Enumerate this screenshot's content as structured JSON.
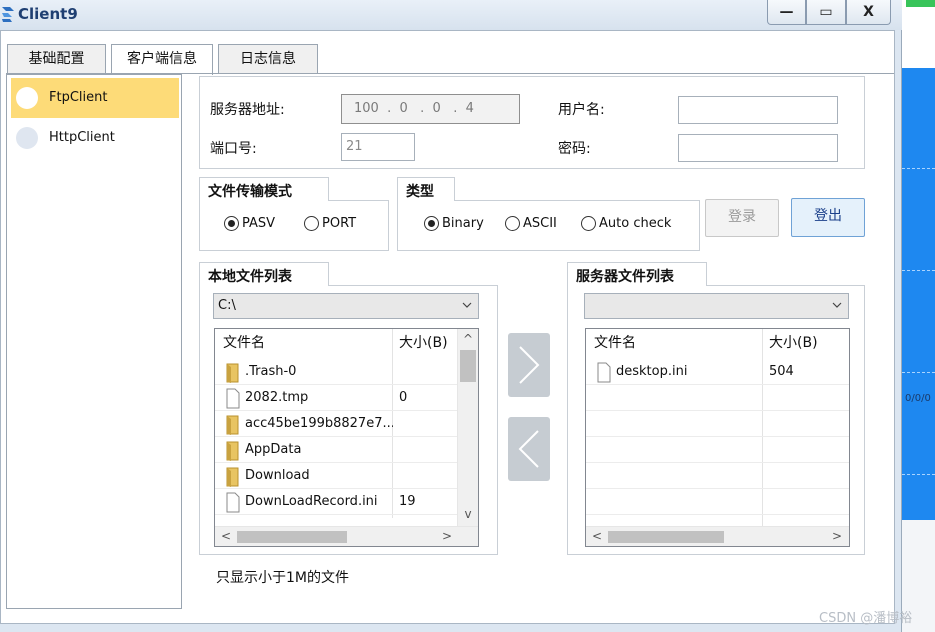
{
  "window": {
    "title": "Client9",
    "controls": {
      "minimize": "—",
      "maximize": "▭",
      "close": "X"
    }
  },
  "tabs": [
    {
      "label": "基础配置",
      "selected": false
    },
    {
      "label": "客户端信息",
      "selected": true
    },
    {
      "label": "日志信息",
      "selected": false
    }
  ],
  "left_list": [
    {
      "label": "FtpClient",
      "selected": true
    },
    {
      "label": "HttpClient",
      "selected": false
    }
  ],
  "connection": {
    "server_addr_label": "服务器地址:",
    "server_addr_value": "100  .  0   .  0   .  4",
    "port_label": "端口号:",
    "port_value": "21",
    "username_label": "用户名:",
    "username_value": "",
    "password_label": "密码:",
    "password_value": ""
  },
  "transfer_mode": {
    "title": "文件传输模式",
    "options": [
      {
        "label": "PASV",
        "checked": true
      },
      {
        "label": "PORT",
        "checked": false
      }
    ]
  },
  "type_group": {
    "title": "类型",
    "options": [
      {
        "label": "Binary",
        "checked": true
      },
      {
        "label": "ASCII",
        "checked": false
      },
      {
        "label": "Auto check",
        "checked": false
      }
    ]
  },
  "buttons": {
    "login": "登录",
    "logout": "登出"
  },
  "local_files": {
    "title": "本地文件列表",
    "path": "C:\\",
    "col_name": "文件名",
    "col_size": "大小(B)",
    "rows": [
      {
        "name": ".Trash-0",
        "size": "",
        "icon": "folder-icon"
      },
      {
        "name": "2082.tmp",
        "size": "0",
        "icon": "file-icon"
      },
      {
        "name": "acc45be199b8827e7...",
        "size": "",
        "icon": "folder-icon"
      },
      {
        "name": "AppData",
        "size": "",
        "icon": "folder-icon"
      },
      {
        "name": "Download",
        "size": "",
        "icon": "folder-icon"
      },
      {
        "name": "DownLoadRecord.ini",
        "size": "19",
        "icon": "file-icon"
      }
    ]
  },
  "server_files": {
    "title": "服务器文件列表",
    "path": "",
    "col_name": "文件名",
    "col_size": "大小(B)",
    "rows": [
      {
        "name": "desktop.ini",
        "size": "504",
        "icon": "file-icon"
      }
    ]
  },
  "transfer_buttons": {
    "upload_glyph": ">",
    "download_glyph": "<"
  },
  "footer_note": "只显示小于1M的文件",
  "watermark": "CSDN @潘博裕",
  "background_app": {
    "partial_label": "0/0/0"
  },
  "colors": {
    "selected_item": "#fddb78",
    "window_bg": "#dce6f1",
    "accent_button": "#e5f1fb",
    "background_app_blue": "#1e88f0"
  }
}
